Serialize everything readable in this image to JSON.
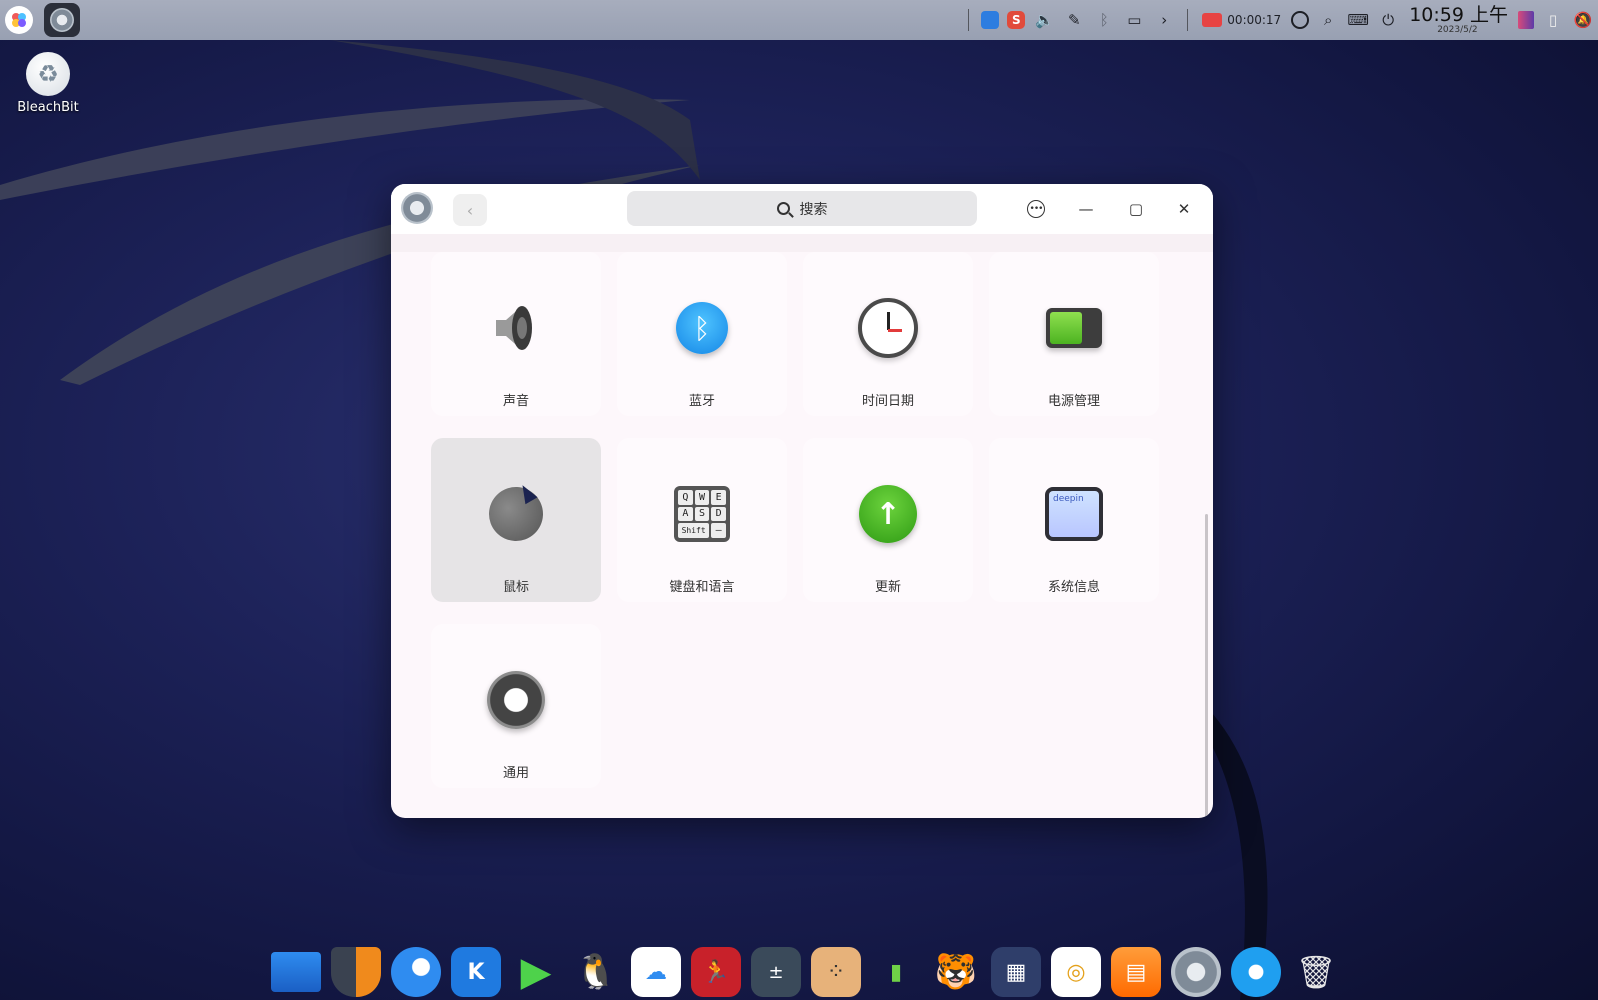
{
  "topbar": {
    "launcher_icon": "launcher-icon",
    "active_app_icon": "control-center-icon",
    "tray": {
      "record_time": "00:00:17",
      "clock_time": "10:59 上午",
      "clock_date": "2023/5/2"
    }
  },
  "desktop": {
    "icons": [
      {
        "label": "BleachBit",
        "icon": "bleachbit-icon"
      }
    ]
  },
  "window": {
    "search_placeholder": "搜索",
    "tiles": [
      {
        "label": "声音",
        "icon": "speaker-icon"
      },
      {
        "label": "蓝牙",
        "icon": "bluetooth-icon"
      },
      {
        "label": "时间日期",
        "icon": "clock-icon"
      },
      {
        "label": "电源管理",
        "icon": "battery-icon"
      },
      {
        "label": "鼠标",
        "icon": "mouse-icon",
        "selected": true
      },
      {
        "label": "键盘和语言",
        "icon": "keyboard-icon"
      },
      {
        "label": "更新",
        "icon": "update-icon"
      },
      {
        "label": "系统信息",
        "icon": "system-info-icon"
      },
      {
        "label": "通用",
        "icon": "gear-icon"
      }
    ],
    "keyboard_keys": [
      "Q",
      "W",
      "E",
      "A",
      "S",
      "D",
      "Shift",
      "–"
    ],
    "sysinfo_brand": "deepin"
  },
  "dock": {
    "items": [
      "computer-icon",
      "security-center-icon",
      "browser-icon",
      "k-app-icon",
      "video-player-icon",
      "qq-icon",
      "cloud-drive-icon",
      "sports-app-icon",
      "calculator-icon",
      "board-game-icon",
      "chip-app-icon",
      "tiger-app-icon",
      "app-store-icon",
      "draw-app-icon",
      "shop-app-icon",
      "control-center-icon",
      "deepin-icon",
      "trash-icon"
    ]
  }
}
